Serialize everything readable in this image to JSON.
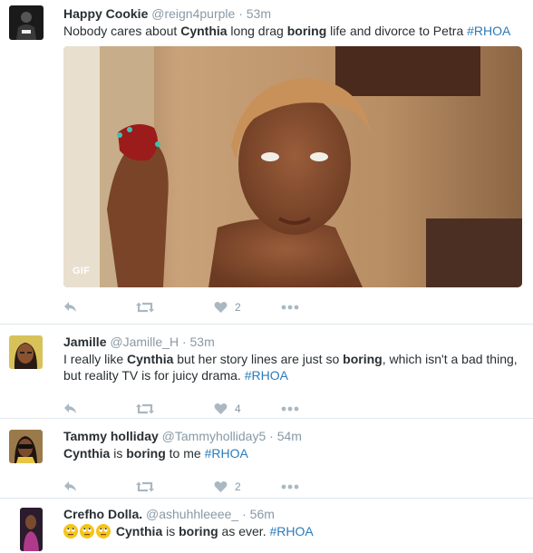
{
  "tweets": [
    {
      "name": "Happy Cookie",
      "handle": "@reign4purple",
      "time": "53m",
      "text_parts": [
        {
          "t": "Nobody cares about ",
          "s": "n"
        },
        {
          "t": "Cynthia",
          "s": "b"
        },
        {
          "t": " long drag ",
          "s": "n"
        },
        {
          "t": "boring",
          "s": "b"
        },
        {
          "t": " life and divorce to Petra ",
          "s": "n"
        },
        {
          "t": "#RHOA",
          "s": "h"
        }
      ],
      "media_badge": "GIF",
      "like_count": "2"
    },
    {
      "name": "Jamille",
      "handle": "@Jamille_H",
      "time": "53m",
      "text_parts": [
        {
          "t": "I really like ",
          "s": "n"
        },
        {
          "t": "Cynthia",
          "s": "b"
        },
        {
          "t": " but her story lines are just so ",
          "s": "n"
        },
        {
          "t": "boring",
          "s": "b"
        },
        {
          "t": ", which isn't a bad thing, but reality TV is for juicy drama. ",
          "s": "n"
        },
        {
          "t": "#RHOA",
          "s": "h"
        }
      ],
      "like_count": "4"
    },
    {
      "name": "Tammy holliday",
      "handle": "@Tammyholliday5",
      "time": "54m",
      "text_parts": [
        {
          "t": "Cynthia",
          "s": "b"
        },
        {
          "t": " is ",
          "s": "n"
        },
        {
          "t": "boring",
          "s": "b"
        },
        {
          "t": " to me ",
          "s": "n"
        },
        {
          "t": "#RHOA",
          "s": "h"
        }
      ],
      "like_count": "2"
    },
    {
      "name": "Crefho Dolla.",
      "handle": "@ashuhhleeee_",
      "time": "56m",
      "text_parts": [
        {
          "t": "Cynthia",
          "s": "b"
        },
        {
          "t": " is ",
          "s": "n"
        },
        {
          "t": "boring",
          "s": "b"
        },
        {
          "t": " as ever. ",
          "s": "n"
        },
        {
          "t": "#RHOA",
          "s": "h"
        }
      ],
      "like_count": ""
    }
  ],
  "separator": "·",
  "icons": {
    "reply": "reply-icon",
    "retweet": "retweet-icon",
    "like": "heart-icon",
    "more": "more-icon",
    "emoji": "rolling-eyes-emoji-icon"
  },
  "colors": {
    "text": "#292f33",
    "muted": "#8899a6",
    "hashtag": "#2b7bb9",
    "icon": "#aab8c2",
    "divider": "#e1e8ed"
  }
}
